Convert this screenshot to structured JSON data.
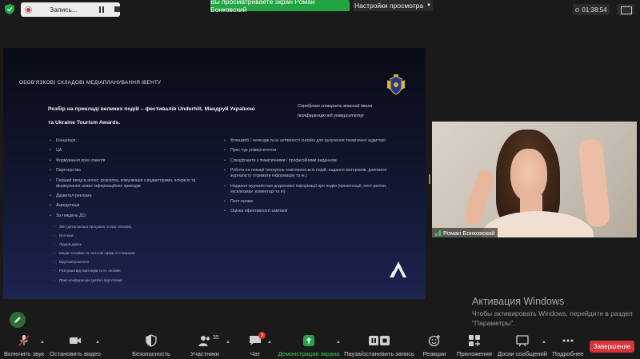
{
  "topbar": {
    "recording_label": "Запись...",
    "share_banner": "Вы просматриваете экран Роман Бонковский",
    "view_settings": "Настройки просмотра",
    "timer": "01:38:54"
  },
  "slide": {
    "title": "ОБОВ'ЯЗКОВІ СКЛАДОВІ МЕДІАПЛАНУВАННЯ ІВЕНТУ",
    "headline": "Розбір на прикладі великих подій – фестивалів Underhill, Мандруй Україною та Ukraine Tourism Awards.",
    "note": "Спробуємо створити власний івент (конференцію від університету)",
    "left_items": [
      "Концепція;",
      "ЦА",
      "Формування прес-пакетів",
      "Партнерства",
      "Перший вихід в анонс: розсилка, комунікація з редакторами, інтерв'ю та формування нових інформаційних приводів",
      "Діджитал-реклама",
      "Акредитація",
      "За тиждень ДО:"
    ],
    "sub_items": [
      "ЗМІ (детальнаша програма та про спікерів),",
      "Блогери,",
      "Лідери думок",
      "Медіа-онлайни та гостьові ефіри зі спікерами",
      "Відеозапрошення",
      "Розіграші від партнерів та ін. онлайн",
      "Прес-конференція (деталі підготовки)"
    ],
    "right_items": [
      "Флешмоб / челендж та ін активності онлайн для залучення тематичної аудиторії",
      "Прес-тур університетом",
      "Спецпроекти з тематичними / професійними виданням",
      "Робота на локації (контроль освітлення всіх подій, надання матеріалів, допомога журналісту отримати інформацію та ін.)",
      "Надання журналістам додаткової інформації про подію (презентації, пост-релізи, ексклюзиви ,коментарі та ін)",
      "Пост-промо",
      "Оцінка ефективності кампанії"
    ]
  },
  "video": {
    "participant_name": "Роман Бонковский"
  },
  "activation": {
    "title": "Активация Windows",
    "subtitle": "Чтобы активировать Windows, перейдите в раздел \"Параметры\"."
  },
  "toolbar": {
    "unmute": "Включить звук",
    "stop_video": "Остановить видео",
    "security": "Безопасность",
    "participants": "Участники",
    "participants_count": "35",
    "chat": "Чат",
    "chat_badge": "3",
    "share_screen": "Демонстрация экрана",
    "pause_recording": "Пауза/остановить запись",
    "reactions": "Реакции",
    "apps": "Приложения",
    "whiteboards": "Доски сообщений",
    "more": "Подробнее",
    "end": "Завершение"
  },
  "colors": {
    "share_green": "#23a544",
    "end_red": "#d7333b",
    "badge_red": "#e02828"
  }
}
